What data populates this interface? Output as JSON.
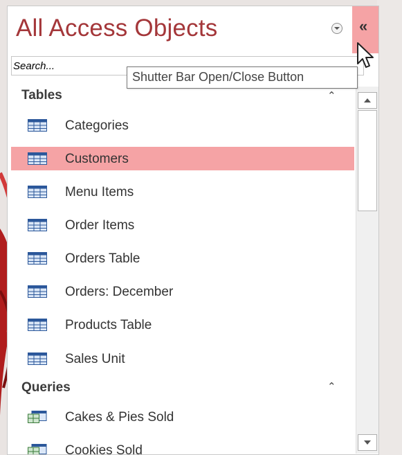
{
  "pane": {
    "title": "All Access Objects",
    "shutter_glyph": "«",
    "search_placeholder": "Search...",
    "tooltip": "Shutter Bar Open/Close Button"
  },
  "groups": {
    "tables": {
      "label": "Tables",
      "items": [
        {
          "label": "Categories"
        },
        {
          "label": "Customers"
        },
        {
          "label": "Menu Items"
        },
        {
          "label": "Order Items"
        },
        {
          "label": "Orders Table"
        },
        {
          "label": "Orders: December"
        },
        {
          "label": "Products Table"
        },
        {
          "label": "Sales Unit"
        }
      ]
    },
    "queries": {
      "label": "Queries",
      "items": [
        {
          "label": "Cakes & Pies Sold"
        },
        {
          "label": "Cookies Sold"
        }
      ]
    }
  },
  "selected_item": "Customers",
  "colors": {
    "title": "#a4373a",
    "highlight": "#f5a3a5",
    "table_icon": "#2b579a"
  },
  "icons": {
    "table": "table-icon",
    "query": "query-icon",
    "collapse": "double-chevron-up-icon",
    "dropdown": "dropdown-circle-icon",
    "shutter": "double-chevron-left-icon"
  }
}
